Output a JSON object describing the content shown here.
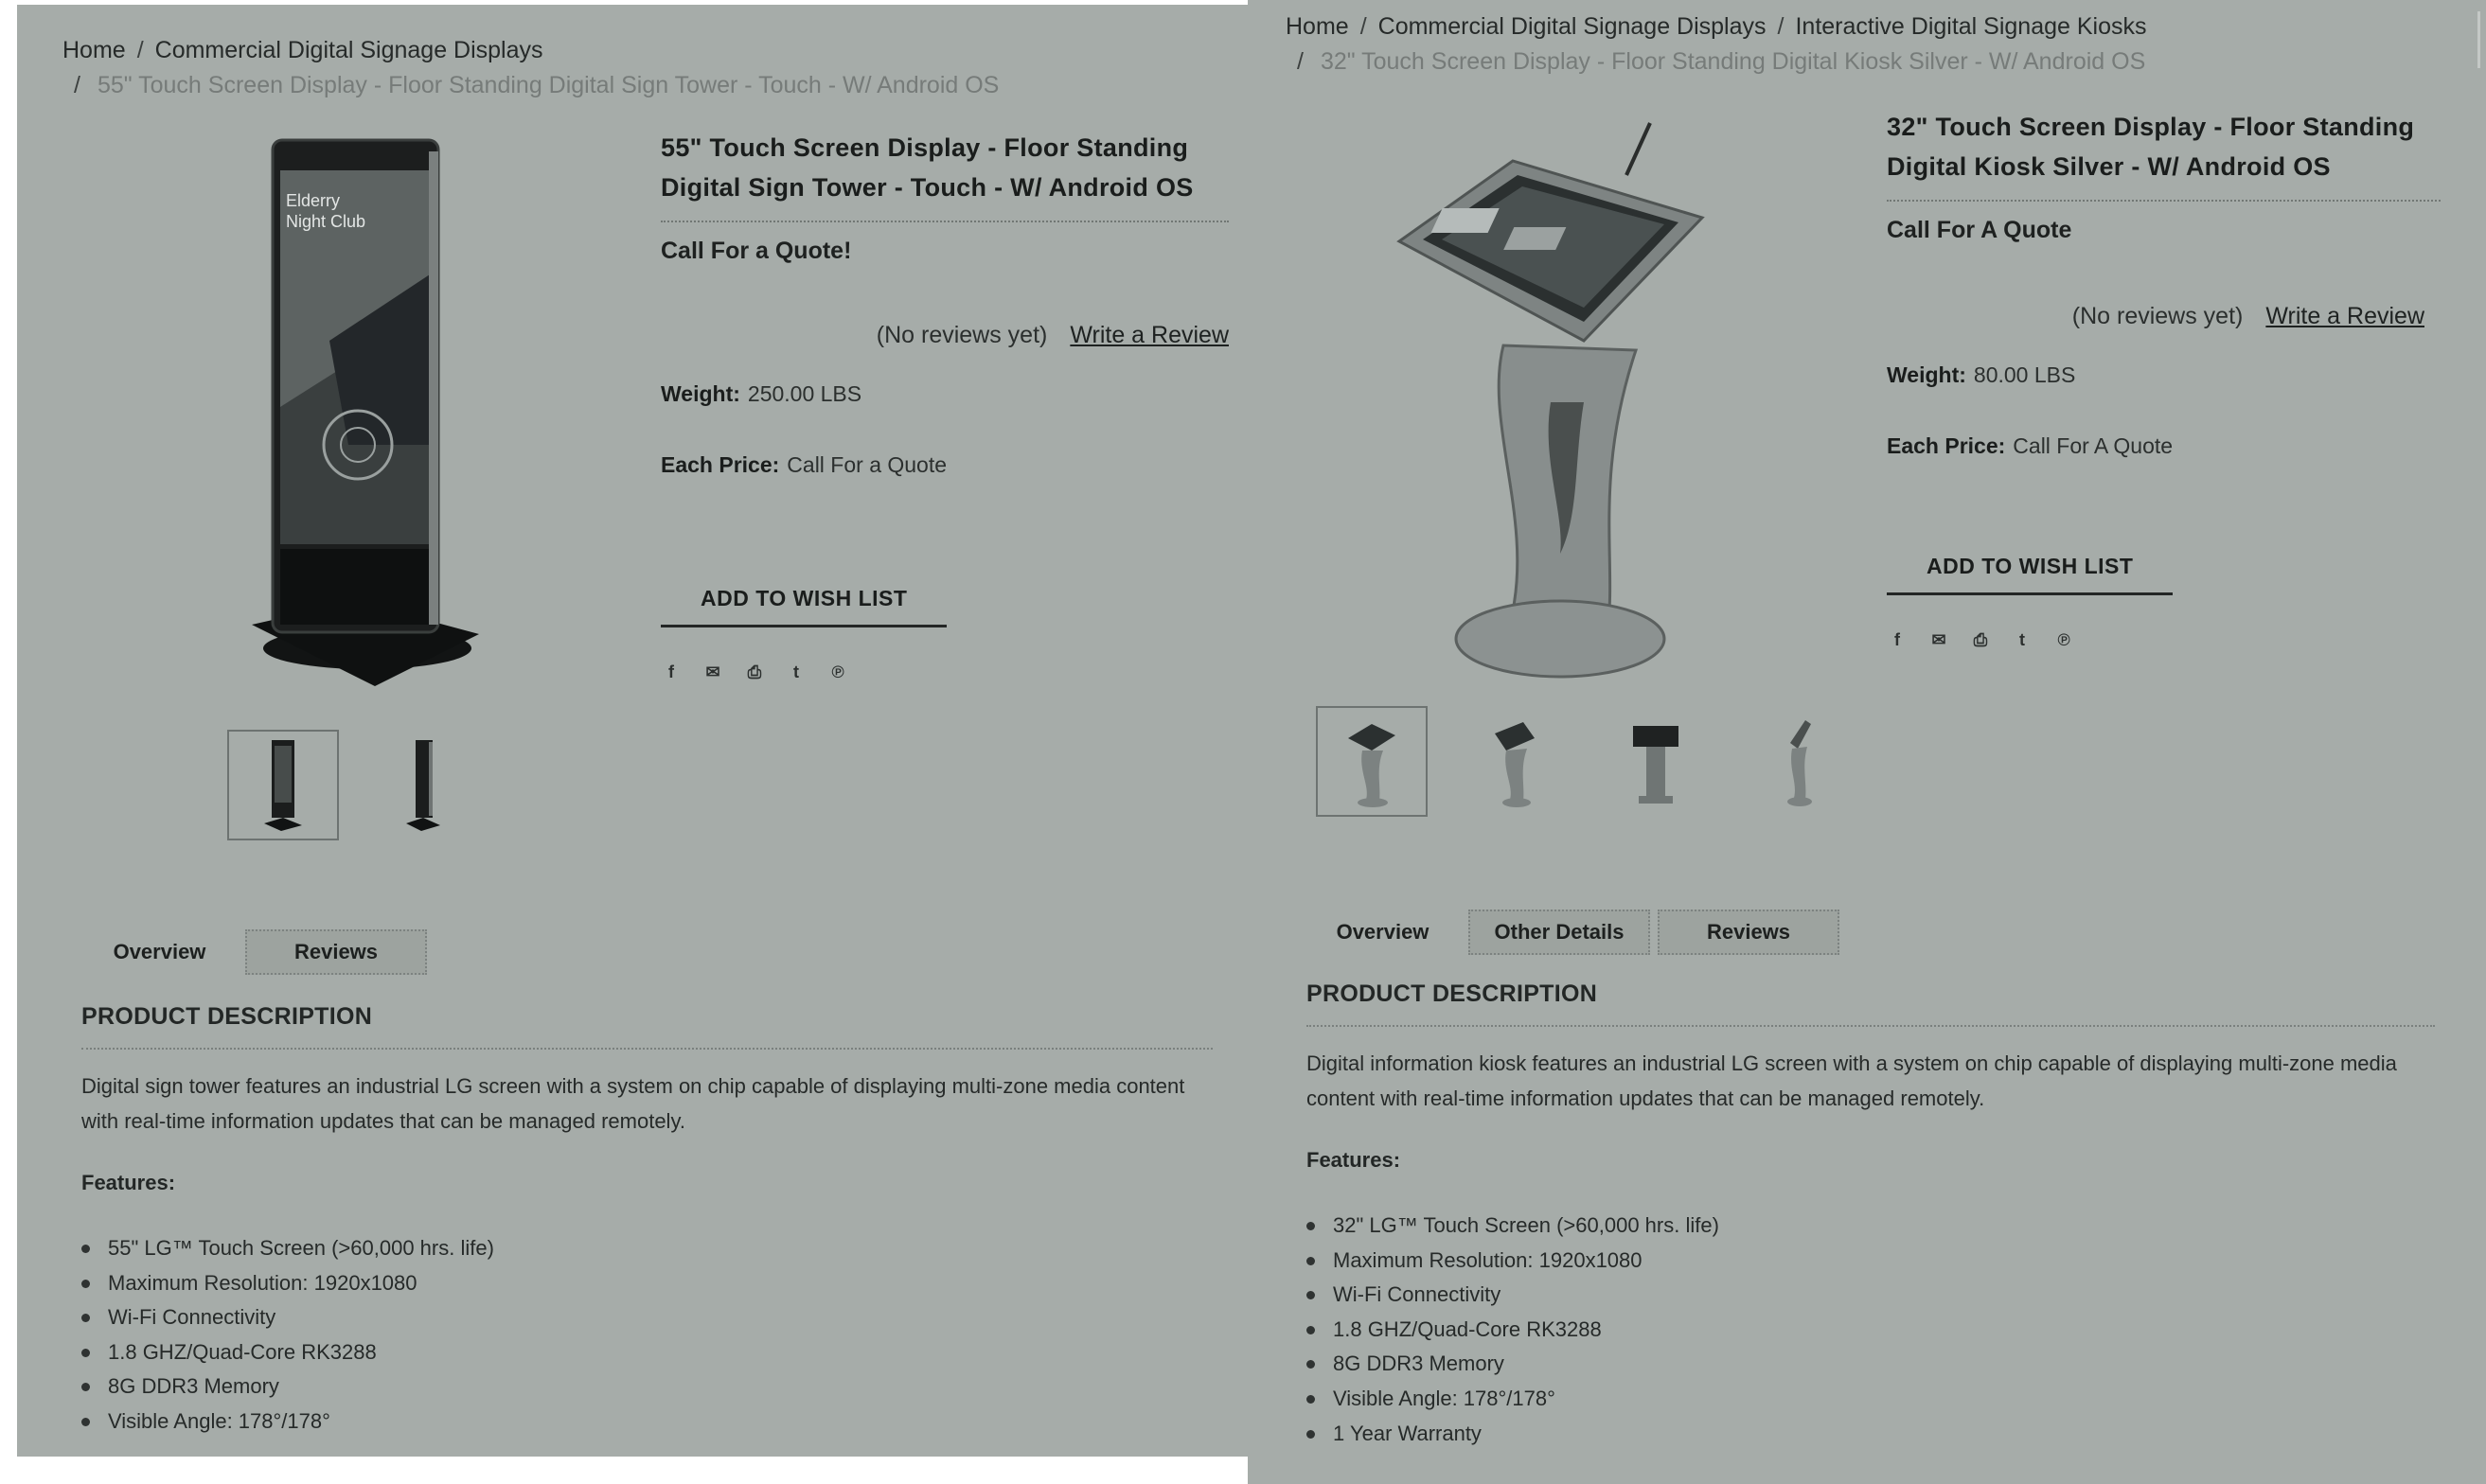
{
  "left": {
    "breadcrumb": {
      "home": "Home",
      "category": "Commercial Digital Signage Displays",
      "current": "55\" Touch Screen Display - Floor Standing Digital Sign Tower - Touch - W/ Android OS"
    },
    "image_screen_text": "Elderry Night Club",
    "title": "55\" Touch Screen Display - Floor Standing Digital Sign Tower - Touch - W/ Android OS",
    "quote": "Call For a Quote!",
    "reviews_text": "(No reviews yet)",
    "write_review": "Write a Review",
    "weight_label": "Weight:",
    "weight_value": "250.00 LBS",
    "price_label": "Each Price:",
    "price_value": "Call For a Quote",
    "wishlist": "ADD TO WISH LIST",
    "tabs": [
      "Overview",
      "Reviews"
    ],
    "desc_heading": "PRODUCT DESCRIPTION",
    "desc_text": "Digital sign tower features an industrial LG screen with a system on chip capable of displaying multi-zone media content with real-time information updates that can be managed remotely.",
    "features_heading": "Features:",
    "features": [
      "55\" LG™ Touch Screen (>60,000 hrs. life)",
      "Maximum Resolution: 1920x1080",
      "Wi-Fi Connectivity",
      "1.8 GHZ/Quad-Core RK3288",
      "8G DDR3 Memory",
      "Visible Angle: 178°/178°"
    ]
  },
  "right": {
    "breadcrumb": {
      "home": "Home",
      "category": "Commercial Digital Signage Displays",
      "subcategory": "Interactive Digital Signage Kiosks",
      "current": "32\" Touch Screen Display - Floor Standing Digital Kiosk Silver - W/ Android OS"
    },
    "title": "32\" Touch Screen Display - Floor Standing Digital Kiosk Silver - W/ Android OS",
    "quote": "Call For A Quote",
    "reviews_text": "(No reviews yet)",
    "write_review": "Write a Review",
    "weight_label": "Weight:",
    "weight_value": "80.00 LBS",
    "price_label": "Each Price:",
    "price_value": "Call For A Quote",
    "wishlist": "ADD TO WISH LIST",
    "tabs": [
      "Overview",
      "Other Details",
      "Reviews"
    ],
    "desc_heading": "PRODUCT DESCRIPTION",
    "desc_text": "Digital information kiosk features an industrial LG screen with a system on chip capable of displaying multi-zone media content with real-time information updates that can be managed remotely.",
    "features_heading": "Features:",
    "features": [
      "32\" LG™ Touch Screen (>60,000 hrs. life)",
      "Maximum Resolution: 1920x1080",
      "Wi-Fi Connectivity",
      "1.8 GHZ/Quad-Core RK3288",
      "8G DDR3 Memory",
      "Visible Angle: 178°/178°",
      "1 Year Warranty"
    ]
  },
  "social_icons": [
    "facebook-icon",
    "email-icon",
    "print-icon",
    "twitter-icon",
    "pinterest-icon"
  ],
  "colors": {
    "panel_bg": "#a6aca9",
    "text_dark": "#1a1d1c",
    "text_muted": "#767b79"
  }
}
